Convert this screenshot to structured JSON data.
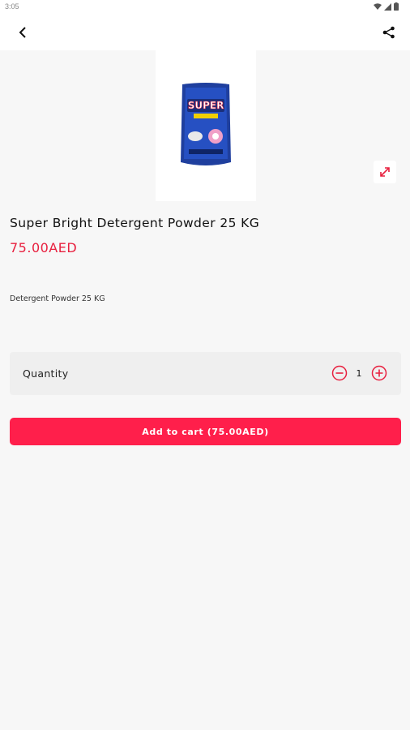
{
  "status_bar": {
    "time": "3:05"
  },
  "product": {
    "title": "Super Bright Detergent Powder 25 KG",
    "price": "75.00AED",
    "description": "Detergent Powder 25 KG",
    "image_alt": "SUPER BRIGHT detergent bag"
  },
  "quantity": {
    "label": "Quantity",
    "value": "1"
  },
  "cart": {
    "button_label": "Add to cart (75.00AED)"
  },
  "colors": {
    "accent": "#ff1f4b",
    "price": "#e8203f",
    "background": "#f7f7f7"
  },
  "icons": [
    "back-arrow-icon",
    "share-icon",
    "expand-icon",
    "minus-circle-icon",
    "plus-circle-icon",
    "wifi-icon",
    "signal-icon",
    "battery-icon"
  ]
}
